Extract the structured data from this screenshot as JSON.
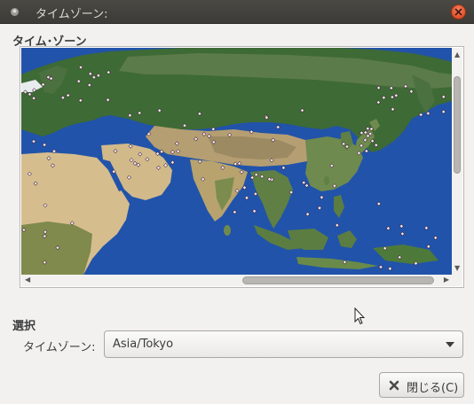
{
  "window": {
    "title": "タイムゾーン:"
  },
  "timezone_section": {
    "heading": "タイム･ゾーン"
  },
  "selection_section": {
    "heading": "選択",
    "timezone_label": "タイムゾーン:",
    "timezone_value": "Asia/Tokyo"
  },
  "buttons": {
    "close_label": "閉じる(C)"
  },
  "colors": {
    "titlebar": "#3c3b37",
    "close_button": "#e5582f",
    "ocean": "#2050a8",
    "window_bg": "#f2f1f0"
  },
  "icons": {
    "window_menu": "window-menu-icon",
    "close": "close-icon",
    "dropdown": "chevron-down-icon",
    "close_button": "x-icon"
  }
}
